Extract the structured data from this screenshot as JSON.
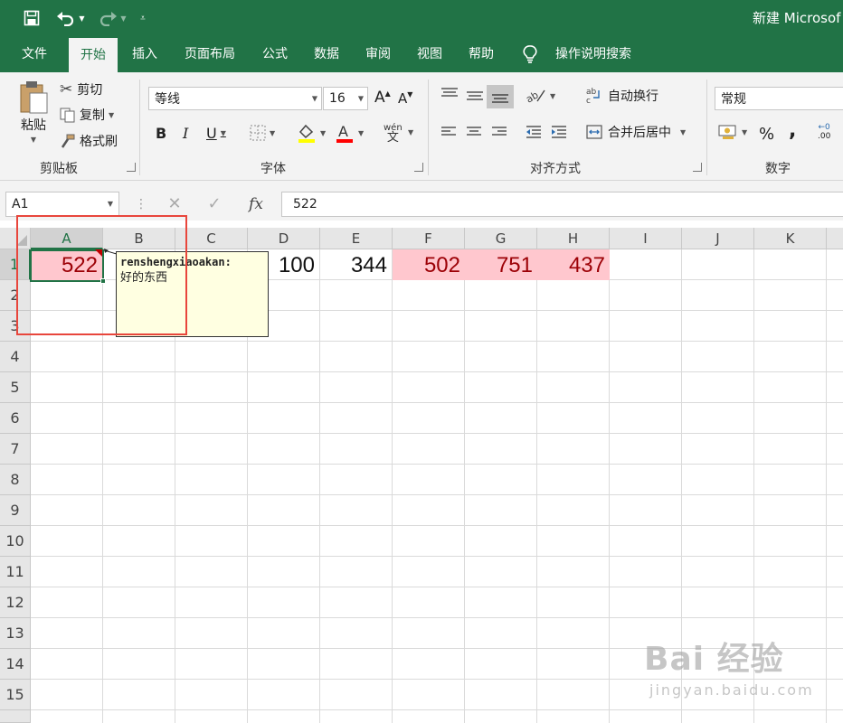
{
  "window": {
    "title": "新建 Microsoft Excel 工作表.xlsx - Excel",
    "visible_title": "新建 Microsof"
  },
  "quick_access": {
    "icons": [
      "save-icon",
      "undo-icon",
      "redo-icon",
      "customize-icon"
    ]
  },
  "tabs": [
    {
      "label": "文件",
      "active": false
    },
    {
      "label": "开始",
      "active": true
    },
    {
      "label": "插入",
      "active": false
    },
    {
      "label": "页面布局",
      "active": false
    },
    {
      "label": "公式",
      "active": false
    },
    {
      "label": "数据",
      "active": false
    },
    {
      "label": "审阅",
      "active": false
    },
    {
      "label": "视图",
      "active": false
    },
    {
      "label": "帮助",
      "active": false
    },
    {
      "label": "操作说明搜索",
      "active": false
    }
  ],
  "ribbon": {
    "clipboard": {
      "label": "剪贴板",
      "paste": "粘贴",
      "cut": "剪切",
      "copy": "复制",
      "format_painter": "格式刷"
    },
    "font": {
      "label": "字体",
      "font_name": "等线",
      "font_size": "16",
      "bold": "B",
      "italic": "I",
      "underline": "U",
      "grow": "A",
      "shrink": "A",
      "phonetic": "wén",
      "font_color": "#ff0000",
      "fill_color": "#ffff00"
    },
    "alignment": {
      "label": "对齐方式",
      "wrap_text": "自动换行",
      "merge_center": "合并后居中"
    },
    "number": {
      "label": "数字",
      "format": "常规",
      "percent": "%",
      "comma": ",",
      "increase_decimal": ".00"
    }
  },
  "formula_bar": {
    "name_box": "A1",
    "cancel": "✕",
    "enter": "✓",
    "fx": "fx",
    "value": "522"
  },
  "sheet": {
    "columns": [
      "A",
      "B",
      "C",
      "D",
      "E",
      "F",
      "G",
      "H",
      "I",
      "J",
      "K"
    ],
    "rows": [
      "1",
      "2",
      "3",
      "4",
      "5",
      "6",
      "7",
      "8",
      "9",
      "10",
      "11",
      "12",
      "13",
      "14",
      "15"
    ],
    "selected_cell": "A1",
    "cells": [
      {
        "ref": "A1",
        "value": "522",
        "highlight": true
      },
      {
        "ref": "D1",
        "value": "100",
        "highlight": false
      },
      {
        "ref": "E1",
        "value": "344",
        "highlight": false
      },
      {
        "ref": "F1",
        "value": "502",
        "highlight": true
      },
      {
        "ref": "G1",
        "value": "751",
        "highlight": true
      },
      {
        "ref": "H1",
        "value": "437",
        "highlight": true
      }
    ],
    "highlight_fill": "#ffc7ce",
    "highlight_text": "#9c0006"
  },
  "comment": {
    "author": "renshengxiaoakan:",
    "text": "好的东西"
  },
  "watermark": {
    "top": "Bai 经验",
    "bottom": "jingyan.baidu.com"
  },
  "colors": {
    "excel_green": "#217346",
    "annotation_red": "#e8463c"
  }
}
